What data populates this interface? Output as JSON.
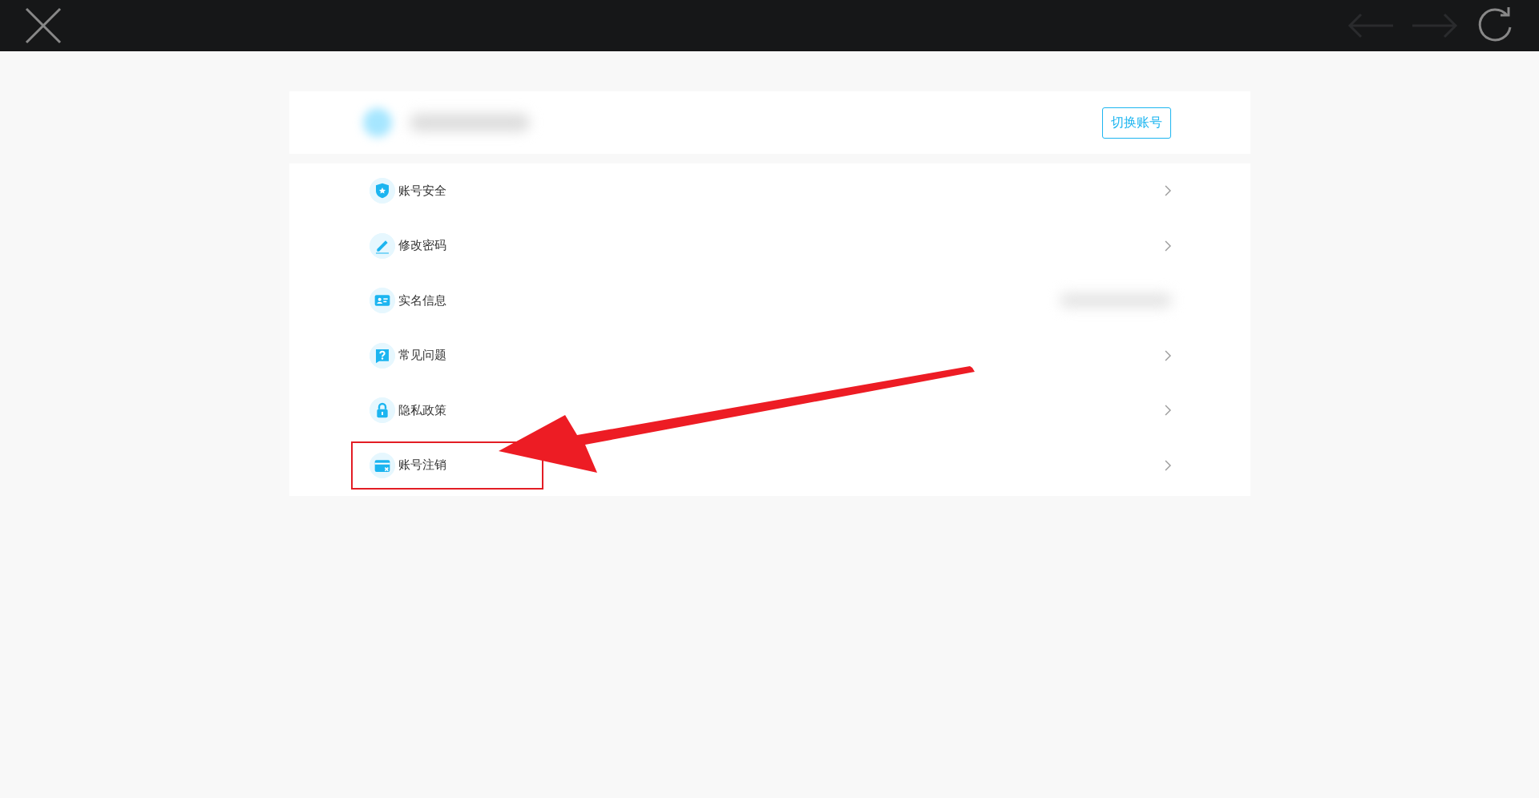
{
  "toolbar": {
    "back_disabled": true,
    "forward_disabled": true
  },
  "account": {
    "switch_button": "切换账号"
  },
  "menu": [
    {
      "label": "账号安全",
      "kind": "shield",
      "chevron": true,
      "highlighted": false
    },
    {
      "label": "修改密码",
      "kind": "pencil",
      "chevron": true,
      "highlighted": false
    },
    {
      "label": "实名信息",
      "kind": "idcard",
      "chevron": false,
      "highlighted": false
    },
    {
      "label": "常见问题",
      "kind": "question",
      "chevron": true,
      "highlighted": false
    },
    {
      "label": "隐私政策",
      "kind": "lock",
      "chevron": true,
      "highlighted": false
    },
    {
      "label": "账号注销",
      "kind": "cardx",
      "chevron": true,
      "highlighted": true
    }
  ]
}
